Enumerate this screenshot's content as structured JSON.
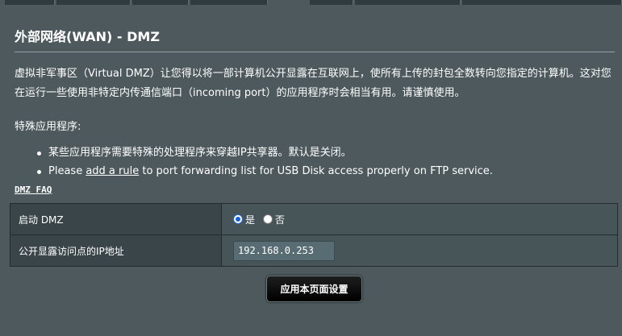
{
  "page": {
    "title": "外部网络(WAN) - DMZ",
    "description": "虚拟非军事区（Virtual DMZ）让您得以将一部计算机公开显露在互联网上，使所有上传的封包全数转向您指定的计算机。这对您在运行一些使用非特定内传通信端口（incoming port）的应用程序时会相当有用。请谨慎使用。",
    "special_apps_label": "特殊应用程序:",
    "bullets": {
      "first": "某些应用程序需要特殊的处理程序来穿越IP共享器。默认是关闭。",
      "second_before": "Please ",
      "second_link": "add a rule",
      "second_after": " to port forwarding list for USB Disk access properly on FTP service."
    },
    "faq_link": "DMZ FAQ"
  },
  "settings": {
    "enable_dmz_label": "启动 DMZ",
    "enable_yes": "是",
    "enable_no": "否",
    "enable_value": "是",
    "exposed_ip_label": "公开显露访问点的IP地址",
    "exposed_ip_value": "192.168.0.253"
  },
  "apply_button": "应用本页面设置"
}
